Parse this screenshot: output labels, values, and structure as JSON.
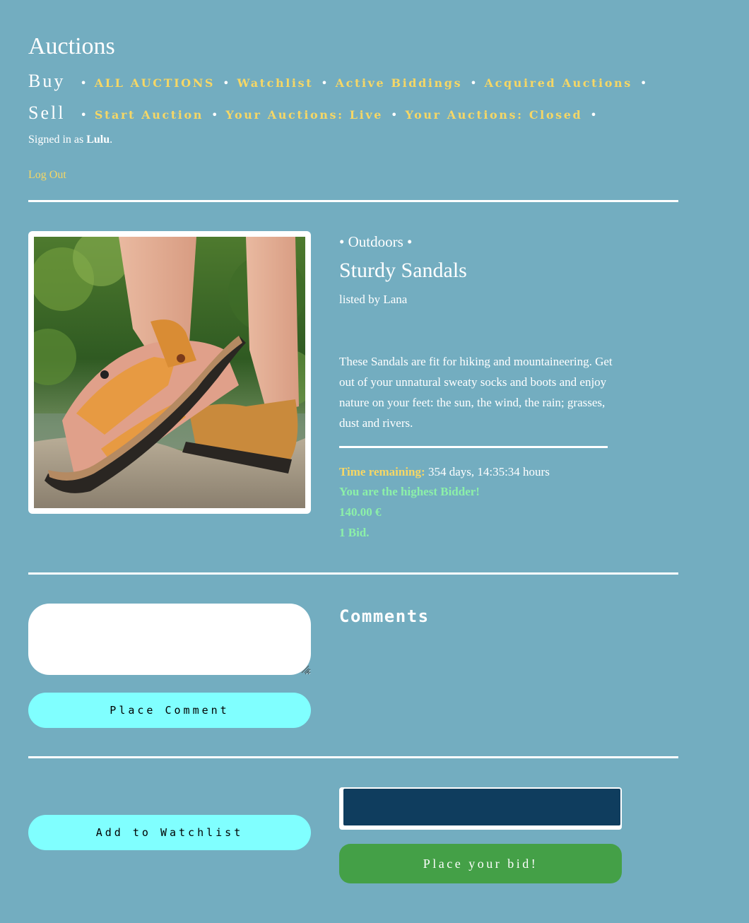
{
  "header": {
    "site_title": "Auctions",
    "buy_label": "Buy",
    "sell_label": "Sell",
    "separator": "•",
    "buy_links": [
      "ALL AUCTIONS",
      "Watchlist",
      "Active Biddings",
      "Acquired Auctions"
    ],
    "sell_links": [
      "Start Auction",
      "Your Auctions: Live",
      "Your Auctions: Closed"
    ],
    "signed_in_prefix": "Signed in as ",
    "username": "Lulu",
    "signed_in_suffix": ".",
    "logout_label": "Log Out"
  },
  "listing": {
    "category_text": "• Outdoors •",
    "title": "Sturdy Sandals",
    "listed_by": "listed by Lana",
    "description": "These Sandals are fit for hiking and mountaineering. Get out of your unnatural sweaty socks and boots and enjoy nature on your feet: the sun, the wind, the rain; grasses, dust and rivers.",
    "time_label": "Time remaining:",
    "time_value": " 354 days, 14:35:34 hours",
    "highest_bidder_text": "You are the highest Bidder!",
    "price": "140.00 €",
    "bid_count": "1 Bid."
  },
  "comments": {
    "input_value": "",
    "button_label": "Place Comment",
    "heading": "Comments"
  },
  "actions": {
    "watchlist_label": "Add to Watchlist",
    "bid_input_value": "",
    "bid_button_label": "Place your bid!"
  },
  "colors": {
    "page_background": "#73adc0",
    "link_yellow": "#f6d765",
    "status_green": "#8cf0a8",
    "cyan_button": "#80ffff",
    "bid_button": "#44a047",
    "bid_input": "#0f3d5e"
  }
}
